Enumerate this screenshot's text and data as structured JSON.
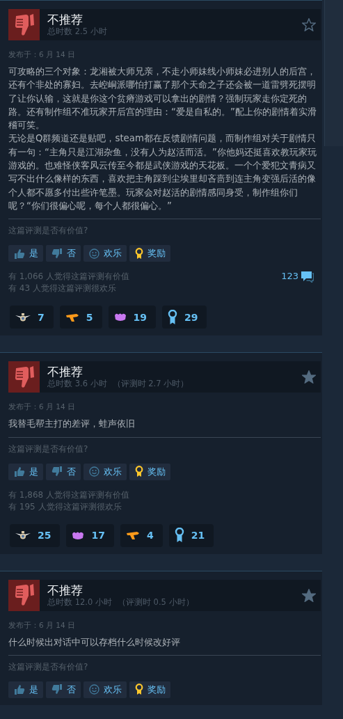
{
  "reviews": [
    {
      "verdict": "不推荐",
      "star_filled": false,
      "hours": "总时数 2.5 小时",
      "date": "发布于：6 月 14 日",
      "body": [
        "可攻略的三个对象：龙湘被大师兄亲，不走小师妹线小师妹必进别人的后宫，还有个非处的寡妇。去崆峒派哪怕打赢了那个天命之子还会被一道雷劈死摆明了让你认输，这就是你这个贫瘠游戏可以拿出的剧情？强制玩家走你定死的路。还有制作组不准玩家开后宫的理由：“爱是自私的。”配上你的剧情着实滑稽可笑。",
        "无论是Q群频道还是贴吧，steam都在反馈剧情问题，而制作组对关于剧情只有一句：“主角只是江湖杂鱼，没有人为赵活而活。”你他妈还挺喜欢教玩家玩游戏的。也难怪侠客风云传至今都是武侠游戏的天花板。一个个爱犯文青病又写不出什么像样的东西，喜欢把主角踩到尘埃里却吝啬到连主角变强后活的像个人都不愿多付出些许笔墨。玩家会对赵活的剧情感同身受，制作组你们呢？“你们很偏心呢，每个人都很偏心。”"
      ],
      "question": "这篇评测是否有价值?",
      "buttons": [
        {
          "kind": "yes",
          "label": "是"
        },
        {
          "kind": "no",
          "label": "否"
        },
        {
          "kind": "funny",
          "label": "欢乐"
        },
        {
          "kind": "award",
          "label": "奖励"
        }
      ],
      "helpful": "有 1,066 人觉得这篇评测有价值",
      "funny": "有 43 人觉得这篇评测很欢乐",
      "comments": "123",
      "awards": [
        {
          "kind": "wings",
          "count": "7"
        },
        {
          "kind": "pistol",
          "count": "5"
        },
        {
          "kind": "hands",
          "count": "19"
        },
        {
          "kind": "ribbon",
          "count": "29"
        }
      ]
    },
    {
      "verdict": "不推荐",
      "star_filled": true,
      "hours": "总时数 3.6 小时",
      "review_hours": "（评测时 2.7 小时）",
      "date": "发布于：6 月 14 日",
      "body": [
        "我替毛帮主打的差评，蛙声依旧"
      ],
      "question": "这篇评测是否有价值?",
      "buttons": [
        {
          "kind": "yes",
          "label": "是"
        },
        {
          "kind": "no",
          "label": "否"
        },
        {
          "kind": "funny",
          "label": "欢乐"
        },
        {
          "kind": "award",
          "label": "奖励"
        }
      ],
      "helpful": "有 1,868 人觉得这篇评测有价值",
      "funny": "有 195 人觉得这篇评测很欢乐",
      "awards": [
        {
          "kind": "wings",
          "count": "25"
        },
        {
          "kind": "hands",
          "count": "17"
        },
        {
          "kind": "pistol",
          "count": "4"
        },
        {
          "kind": "ribbon",
          "count": "21"
        }
      ]
    },
    {
      "verdict": "不推荐",
      "star_filled": true,
      "hours": "总时数 12.0 小时",
      "review_hours": "（评测时 0.5 小时）",
      "date": "发布于：6 月 14 日",
      "body": [
        "什么时候出对话中可以存档什么时候改好评"
      ],
      "question": "这篇评测是否有价值?",
      "buttons": [
        {
          "kind": "yes",
          "label": "是"
        },
        {
          "kind": "no",
          "label": "否"
        },
        {
          "kind": "funny",
          "label": "欢乐"
        },
        {
          "kind": "award",
          "label": "奖励"
        }
      ]
    }
  ]
}
